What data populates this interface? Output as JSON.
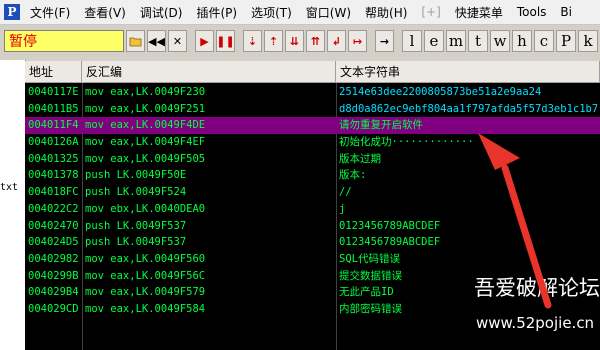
{
  "menu": {
    "logo": "P",
    "items": [
      "文件(F)",
      "查看(V)",
      "调试(D)",
      "插件(P)",
      "选项(T)",
      "窗口(W)",
      "帮助(H)",
      "[+]",
      "快捷菜单",
      "Tools",
      "Bi"
    ]
  },
  "toolbar": {
    "status": "暂停",
    "buttons": [
      "open-file",
      "rewind",
      "close",
      "run",
      "pause",
      "step-into",
      "step-over",
      "trace-into",
      "trace-over",
      "execute-till-return",
      "goto-cursor"
    ],
    "letters": [
      "l",
      "e",
      "m",
      "t",
      "w",
      "h",
      "c",
      "P",
      "k"
    ]
  },
  "sidebar": {
    "fragment": "txt"
  },
  "table": {
    "headers": {
      "address": "地址",
      "disasm": "反汇编",
      "string": "文本字符串"
    },
    "rows": [
      {
        "address": "0040117E",
        "disasm": "mov eax,LK.0049F230",
        "string": "2514e63dee2200805873be51a2e9aa24"
      },
      {
        "address": "004011B5",
        "disasm": "mov eax,LK.0049F251",
        "string": "d8d0a862ec9ebf804aa1f797afda5f57d3eb1c1b7"
      },
      {
        "address": "004011F4",
        "disasm": "mov eax,LK.0049F4DE",
        "string": "请勿重复开启软件"
      },
      {
        "address": "0040126A",
        "disasm": "mov eax,LK.0049F4EF",
        "string": "初始化成功·············"
      },
      {
        "address": "00401325",
        "disasm": "mov eax,LK.0049F505",
        "string": "版本过期"
      },
      {
        "address": "00401378",
        "disasm": "push LK.0049F50E",
        "string": "版本:"
      },
      {
        "address": "004018FC",
        "disasm": "push LK.0049F524",
        "string": "//"
      },
      {
        "address": "004022C2",
        "disasm": "mov ebx,LK.0040DEA0",
        "string": "j"
      },
      {
        "address": "00402470",
        "disasm": "push LK.0049F537",
        "string": "0123456789ABCDEF"
      },
      {
        "address": "004024D5",
        "disasm": "push LK.0049F537",
        "string": "0123456789ABCDEF"
      },
      {
        "address": "00402982",
        "disasm": "mov eax,LK.0049F560",
        "string": "SQL代码错误"
      },
      {
        "address": "0040299B",
        "disasm": "mov eax,LK.0049F56C",
        "string": "提交数据错误"
      },
      {
        "address": "004029B4",
        "disasm": "mov eax,LK.0049F579",
        "string": "无此产品ID"
      },
      {
        "address": "004029CD",
        "disasm": "mov eax,LK.0049F584",
        "string": "内部密码错误"
      }
    ]
  },
  "watermark": {
    "title": "吾爱破解论坛",
    "url": "www.52pojie.cn"
  },
  "colors": {
    "code_text": "#00ff40",
    "selection": "#800080",
    "status_bg": "#ffff66",
    "status_text": "#e00000",
    "arrow": "#e8342a"
  }
}
